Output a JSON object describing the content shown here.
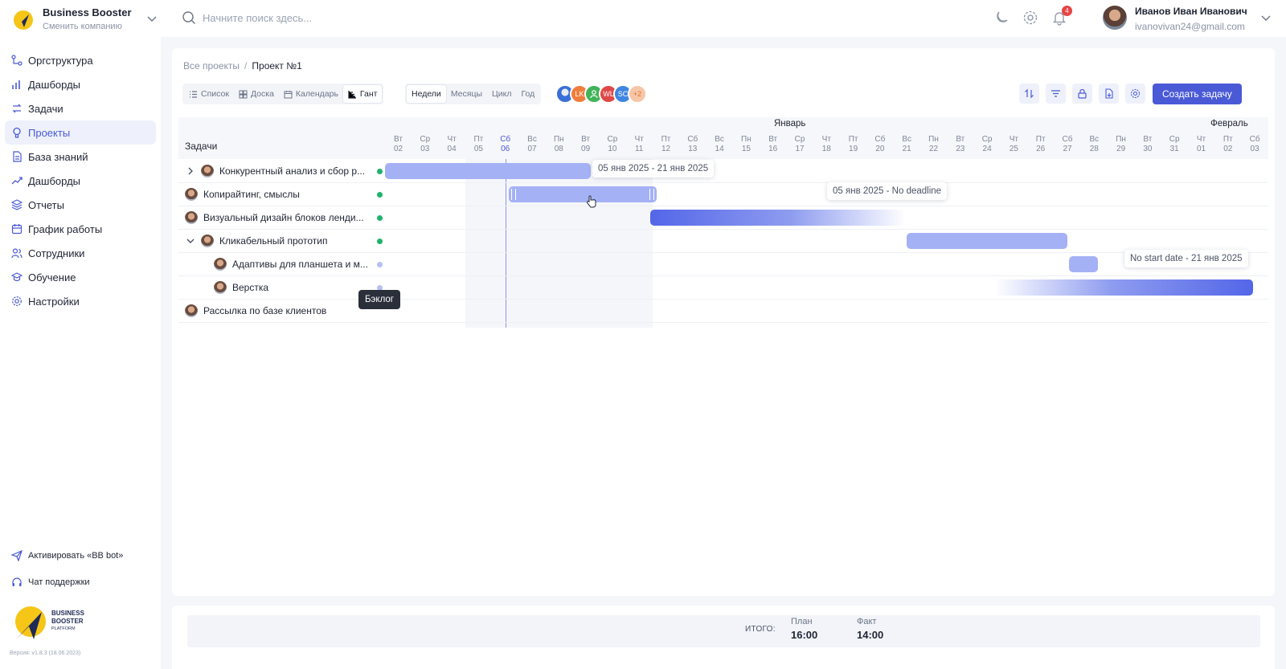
{
  "company": {
    "name": "Business Booster",
    "switch_label": "Сменить компанию"
  },
  "sidebar": {
    "items": [
      {
        "label": "Оргструктура",
        "icon": "org-icon"
      },
      {
        "label": "Дашборды",
        "icon": "chart-bars-icon"
      },
      {
        "label": "Задачи",
        "icon": "tasks-icon"
      },
      {
        "label": "Проекты",
        "icon": "bulb-icon",
        "active": true
      },
      {
        "label": "База знаний",
        "icon": "book-icon"
      },
      {
        "label": "Дашборды",
        "icon": "trend-icon"
      },
      {
        "label": "Отчеты",
        "icon": "layers-icon"
      },
      {
        "label": "График работы",
        "icon": "calendar-icon"
      },
      {
        "label": "Сотрудники",
        "icon": "users-icon"
      },
      {
        "label": "Обучение",
        "icon": "graduation-icon"
      },
      {
        "label": "Настройки",
        "icon": "gear-icon"
      }
    ],
    "bot_link": "Активировать «BB bot»",
    "support_link": "Чат поддержки",
    "logo_text": [
      "BUSINESS",
      "BOOSTER",
      "PLATFORM"
    ],
    "version": "Версия: v1.8.3 (18.06.2023)"
  },
  "search": {
    "placeholder": "Начните поиск здесь..."
  },
  "notifications": {
    "count": "4"
  },
  "user": {
    "name": "Иванов Иван Иванович",
    "email": "ivanovivan24@gmail.com"
  },
  "breadcrumb": {
    "root": "Все проекты",
    "separator": "/",
    "current": "Проект №1"
  },
  "views": {
    "list": "Список",
    "board": "Доска",
    "calendar": "Календарь",
    "gantt": "Гант"
  },
  "periods": {
    "weeks": "Недели",
    "months": "Месяцы",
    "cycle": "Цикл",
    "year": "Год"
  },
  "members": [
    {
      "initials": "",
      "color": "#3b6fd8",
      "kind": "photo"
    },
    {
      "initials": "LK",
      "color": "#f07d3c"
    },
    {
      "initials": "",
      "color": "#43b35a",
      "kind": "user-icon"
    },
    {
      "initials": "WL",
      "color": "#e04848"
    },
    {
      "initials": "SC",
      "color": "#3f86e0"
    },
    {
      "initials": "+2",
      "color": "#f6c6a8",
      "text_color": "#e0742d"
    }
  ],
  "toolbar": {
    "create_task": "Создать задачу"
  },
  "gantt": {
    "tasks_header": "Задачи",
    "months": [
      "Январь",
      "Февраль"
    ],
    "days": [
      [
        "Вт",
        "02"
      ],
      [
        "Ср",
        "03"
      ],
      [
        "Чт",
        "04"
      ],
      [
        "Пт",
        "05"
      ],
      [
        "Сб",
        "06"
      ],
      [
        "Вс",
        "07"
      ],
      [
        "Пн",
        "08"
      ],
      [
        "Вт",
        "09"
      ],
      [
        "Ср",
        "10"
      ],
      [
        "Чт",
        "11"
      ],
      [
        "Пт",
        "12"
      ],
      [
        "Сб",
        "13"
      ],
      [
        "Вс",
        "14"
      ],
      [
        "Пн",
        "15"
      ],
      [
        "Вт",
        "16"
      ],
      [
        "Ср",
        "17"
      ],
      [
        "Чт",
        "18"
      ],
      [
        "Пт",
        "19"
      ],
      [
        "Сб",
        "20"
      ],
      [
        "Вс",
        "21"
      ],
      [
        "Пн",
        "22"
      ],
      [
        "Вт",
        "23"
      ],
      [
        "Ср",
        "24"
      ],
      [
        "Чт",
        "25"
      ],
      [
        "Пт",
        "26"
      ],
      [
        "Сб",
        "27"
      ],
      [
        "Вс",
        "28"
      ],
      [
        "Пн",
        "29"
      ],
      [
        "Вт",
        "30"
      ],
      [
        "Ср",
        "31"
      ],
      [
        "Чт",
        "01"
      ],
      [
        "Пт",
        "02"
      ],
      [
        "Сб",
        "03"
      ]
    ],
    "today_index": 4,
    "rows": [
      {
        "name": "Конкурентный анализ и сбор р...",
        "level": 0,
        "toggle": "chevron-right-icon",
        "status": "#1fb36b"
      },
      {
        "name": "Копирайтинг, смыслы",
        "level": 0,
        "toggle": null,
        "status": "#1fb36b"
      },
      {
        "name": "Визуальный дизайн блоков ленди...",
        "level": 0,
        "toggle": null,
        "status": "#1fb36b"
      },
      {
        "name": "Кликабельный прототип",
        "level": 0,
        "toggle": "chevron-down-icon",
        "status": "#1fb36b"
      },
      {
        "name": "Адаптивы для планшета и м...",
        "level": 1,
        "toggle": null,
        "status": "#b7c0f3"
      },
      {
        "name": "Верстка",
        "level": 1,
        "toggle": null,
        "status": "#b7c0f3"
      },
      {
        "name": "Рассылка по базе клиентов",
        "level": 0,
        "toggle": null,
        "status": null
      }
    ],
    "tooltips": {
      "row1": "05 янв 2025 - 21 янв 2025",
      "row2": "05 янв 2025 - No deadline",
      "row5": "No start date - 21 янв 2025",
      "backlog": "Бэклог"
    }
  },
  "footer": {
    "total_label": "ИТОГО:",
    "plan_label": "План",
    "plan_value": "16:00",
    "fact_label": "Факт",
    "fact_value": "14:00"
  }
}
